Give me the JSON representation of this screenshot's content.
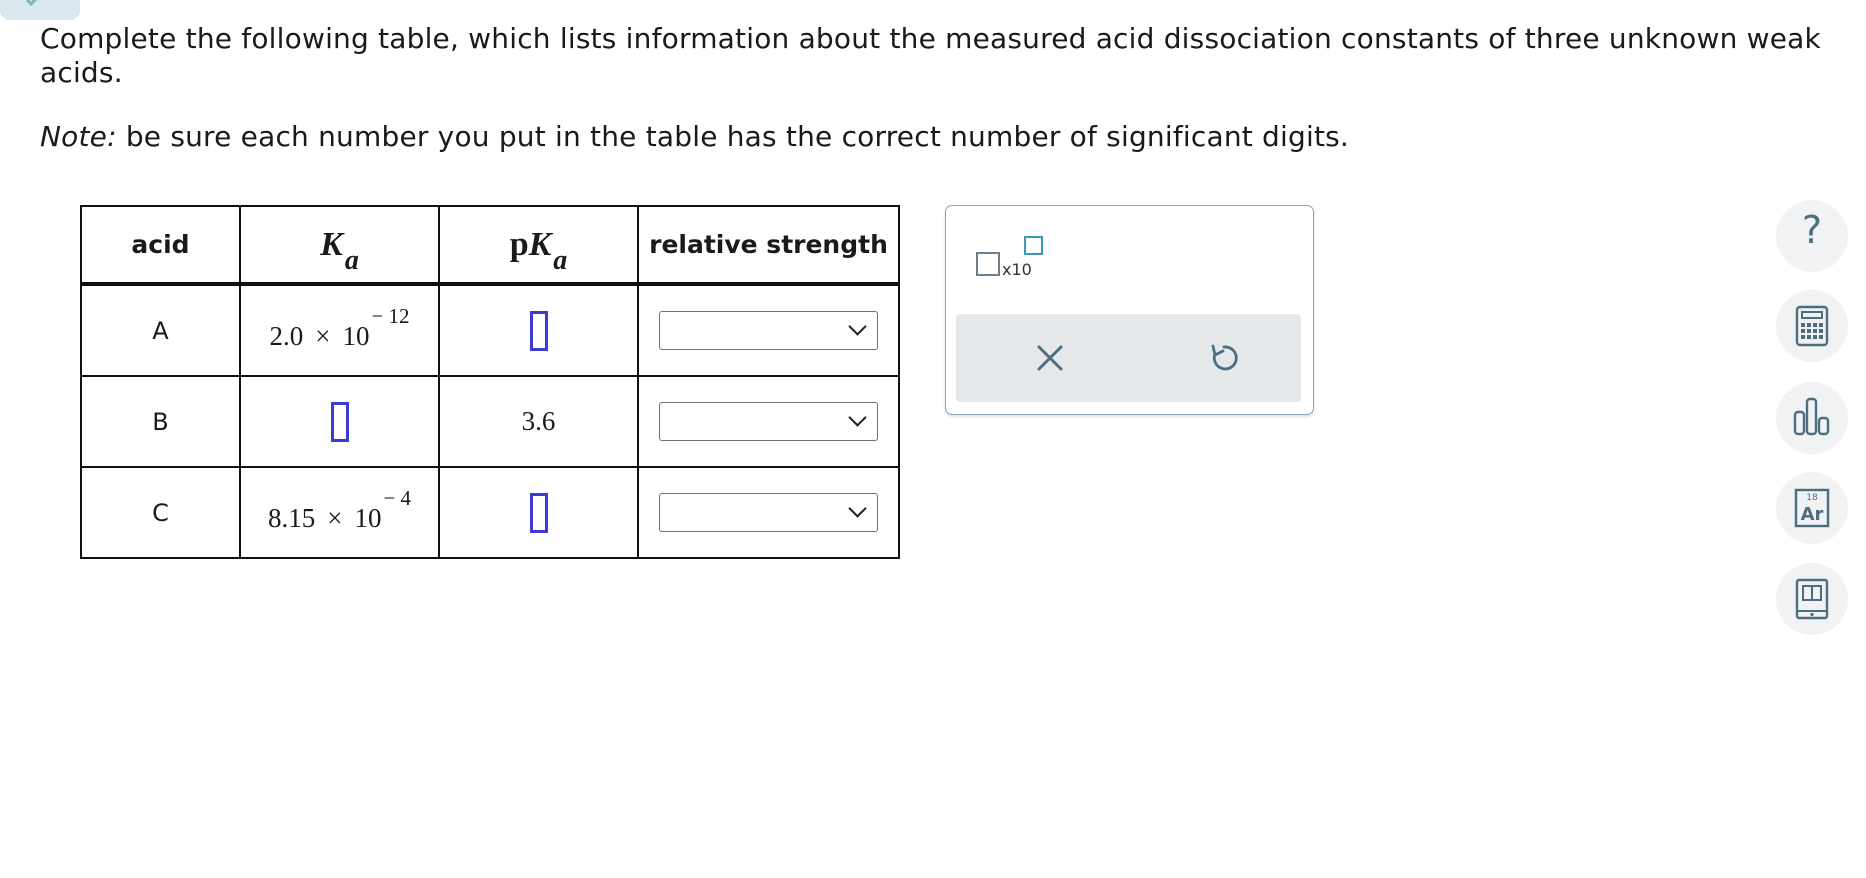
{
  "question": {
    "text": "Complete the following table, which lists information about the measured acid dissociation constants of three unknown weak acids.",
    "note_label": "Note:",
    "note_text": " be sure each number you put in the table has the correct number of significant digits."
  },
  "table": {
    "headers": {
      "acid": "acid",
      "ka_symbol": "K",
      "ka_subscript": "a",
      "pka_p": "p",
      "pka_symbol": "K",
      "pka_subscript": "a",
      "relative_strength": "relative strength"
    },
    "rows": [
      {
        "acid": "A",
        "ka_mantissa": "2.0",
        "ka_times": "×",
        "ka_base": "10",
        "ka_exponent": "− 12",
        "pka": null
      },
      {
        "acid": "B",
        "ka": null,
        "pka": "3.6"
      },
      {
        "acid": "C",
        "ka_mantissa": "8.15",
        "ka_times": "×",
        "ka_base": "10",
        "ka_exponent": "− 4",
        "pka": null
      }
    ],
    "relative_strength_selected": [
      "",
      "",
      ""
    ]
  },
  "tool_panel": {
    "sci_notation_label": "x10",
    "close_icon": "close-icon",
    "undo_icon": "undo-icon"
  },
  "side_toolbar": {
    "help_glyph": "?",
    "icons": [
      "help-icon",
      "calculator-icon",
      "data-chart-icon",
      "periodic-table-icon",
      "reference-book-icon"
    ],
    "periodic_number": "18",
    "periodic_symbol": "Ar"
  },
  "colors": {
    "answer_box_border": "#3b3bd6",
    "panel_border": "#8aa7b6",
    "sci_exp_box": "#3d98b8",
    "icon_color": "#4d6e80",
    "action_bar_bg": "#e5e8ea"
  }
}
